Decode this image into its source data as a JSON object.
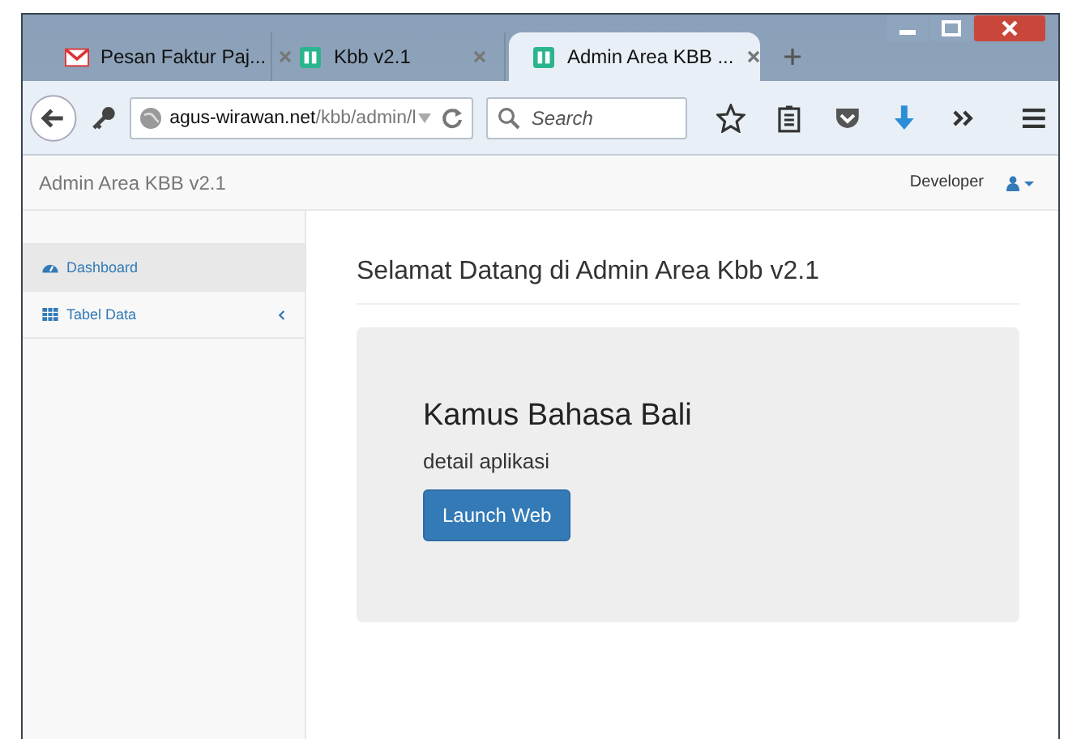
{
  "browser": {
    "tabs": [
      {
        "kind": "gmail",
        "label": "Pesan Faktur Paj...",
        "selected": false
      },
      {
        "kind": "kbb",
        "label": "Kbb v2.1",
        "selected": false
      },
      {
        "kind": "kbb",
        "label": "Admin Area KBB ...",
        "selected": true
      }
    ],
    "url": {
      "host": "agus-wirawan.net",
      "path": "/kbb/admin/l"
    },
    "search": {
      "placeholder": "Search"
    }
  },
  "navbar": {
    "brand": "Admin Area KBB v2.1",
    "user": "Developer"
  },
  "sidebar": {
    "items": [
      {
        "kind": "dashboard",
        "label": "Dashboard",
        "selected": true,
        "expandable": false
      },
      {
        "kind": "table",
        "label": "Tabel Data",
        "selected": false,
        "expandable": true
      }
    ]
  },
  "main": {
    "heading": "Selamat Datang di Admin Area Kbb v2.1",
    "jumbotron": {
      "title": "Kamus Bahasa Bali",
      "subtitle": "detail aplikasi",
      "button": "Launch Web"
    }
  }
}
